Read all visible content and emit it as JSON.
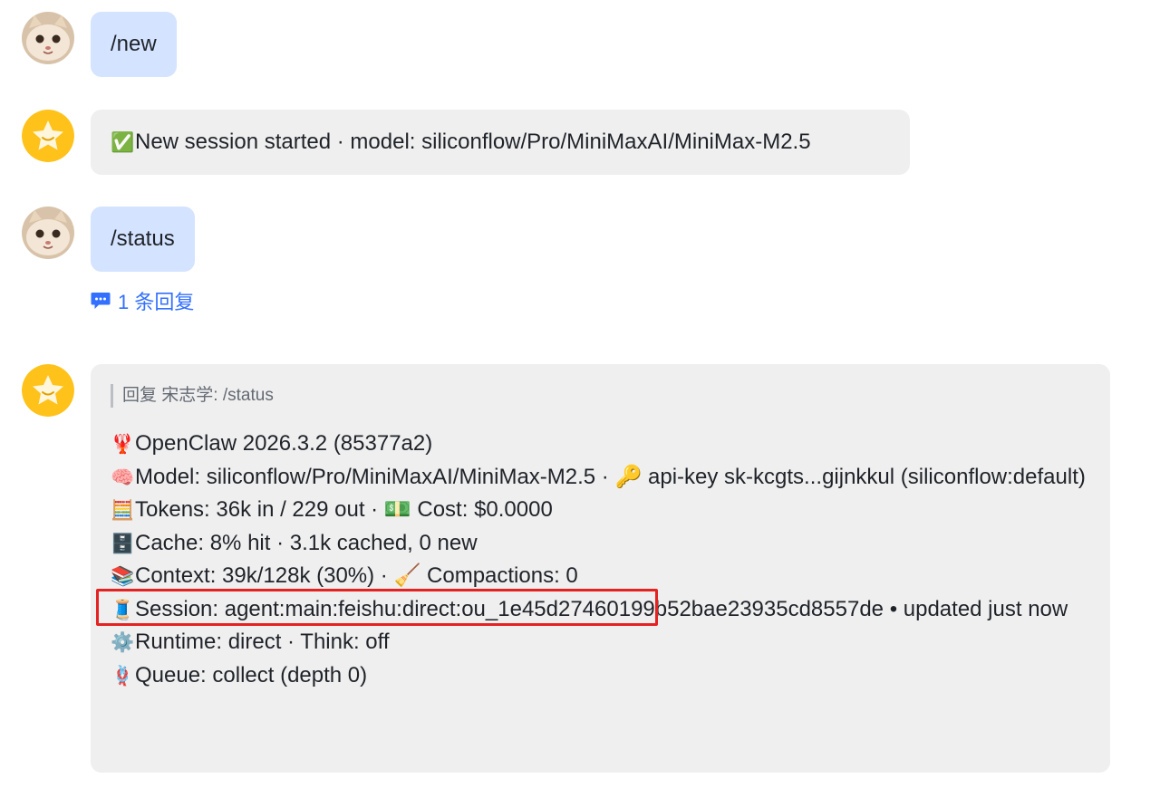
{
  "messages": [
    {
      "role": "user",
      "text": "/new"
    },
    {
      "role": "bot",
      "emoji": "✅",
      "text": "New session started · model: siliconflow/Pro/MiniMaxAI/MiniMax-M2.5"
    },
    {
      "role": "user",
      "text": "/status"
    }
  ],
  "thread": {
    "icon": "speech-bubble-icon",
    "label": "1 条回复"
  },
  "reply": {
    "quote_label": "回复 宋志学:",
    "quote_text": "/status",
    "lines": [
      {
        "emoji": "🦞",
        "text": "OpenClaw 2026.3.2 (85377a2)"
      },
      {
        "emoji": "🧠",
        "text": "Model: siliconflow/Pro/MiniMaxAI/MiniMax-M2.5 · 🔑 api-key sk-kcgts...gijnkkul (siliconflow:default)"
      },
      {
        "emoji": "🧮",
        "text": "Tokens: 36k in / 229 out · 💵 Cost: $0.0000"
      },
      {
        "emoji": "🗄️",
        "text": "Cache: 8% hit · 3.1k cached, 0 new"
      },
      {
        "emoji": "📚",
        "text": "Context: 39k/128k (30%) · 🧹 Compactions: 0"
      },
      {
        "emoji": "🧵",
        "text": "Session: agent:main:feishu:direct:ou_1e45d27460199b52bae23935cd8557de • updated just now"
      },
      {
        "emoji": "⚙️",
        "text": "Runtime: direct · Think: off"
      },
      {
        "emoji": "🪢",
        "text": "Queue: collect (depth 0)"
      }
    ]
  },
  "colors": {
    "user_bubble": "#d4e3ff",
    "bot_bubble": "#efefef",
    "link": "#3370ff",
    "highlight_border": "#e52222",
    "bot_avatar": "#ffc21a"
  }
}
